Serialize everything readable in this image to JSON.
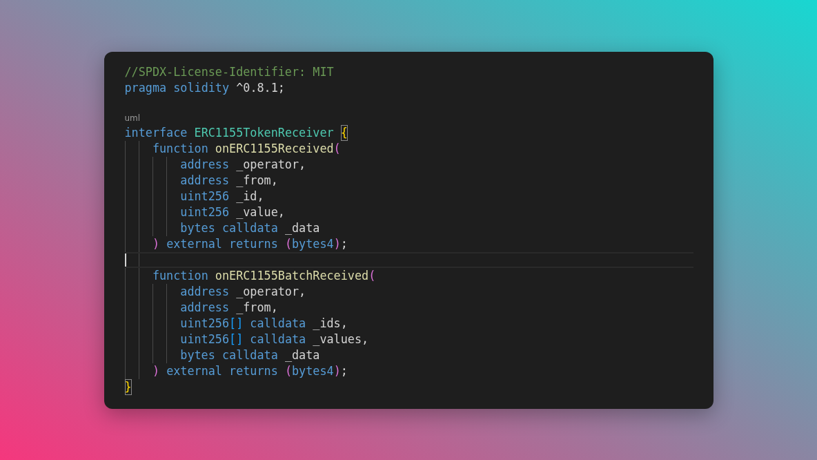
{
  "editor": {
    "lines": [
      {
        "kind": "code",
        "current": false,
        "tokens": [
          {
            "kind": "comment",
            "text": "//SPDX-License-Identifier: MIT"
          }
        ]
      },
      {
        "kind": "code",
        "current": false,
        "tokens": [
          {
            "kind": "keyword",
            "text": "pragma "
          },
          {
            "kind": "keyword",
            "text": "solidity "
          },
          {
            "kind": "plain",
            "text": "^0.8.1;"
          }
        ]
      },
      {
        "kind": "code",
        "current": false
      },
      {
        "kind": "lens",
        "current": false,
        "text": "uml"
      },
      {
        "kind": "code",
        "current": false,
        "tokens": [
          {
            "kind": "keyword",
            "text": "interface "
          },
          {
            "kind": "name",
            "text": "ERC1155TokenReceiver "
          },
          {
            "kind": "brace",
            "text": "{",
            "matched": true
          }
        ],
        "children": [
          {
            "kind": "code",
            "current": false,
            "tokens": [
              {
                "kind": "keyword",
                "text": "function "
              },
              {
                "kind": "function",
                "text": "onERC1155Received"
              },
              {
                "kind": "paren",
                "text": "("
              }
            ],
            "children": [
              {
                "kind": "code",
                "current": false,
                "tokens": [
                  {
                    "kind": "type",
                    "text": "address "
                  },
                  {
                    "kind": "plain",
                    "text": "_operator,"
                  }
                ]
              },
              {
                "kind": "code",
                "current": false,
                "tokens": [
                  {
                    "kind": "type",
                    "text": "address "
                  },
                  {
                    "kind": "plain",
                    "text": "_from,"
                  }
                ]
              },
              {
                "kind": "code",
                "current": false,
                "tokens": [
                  {
                    "kind": "type",
                    "text": "uint256 "
                  },
                  {
                    "kind": "plain",
                    "text": "_id,"
                  }
                ]
              },
              {
                "kind": "code",
                "current": false,
                "tokens": [
                  {
                    "kind": "type",
                    "text": "uint256 "
                  },
                  {
                    "kind": "plain",
                    "text": "_value,"
                  }
                ]
              },
              {
                "kind": "code",
                "current": false,
                "tokens": [
                  {
                    "kind": "type",
                    "text": "bytes "
                  },
                  {
                    "kind": "keyword",
                    "text": "calldata "
                  },
                  {
                    "kind": "plain",
                    "text": "_data"
                  }
                ]
              }
            ]
          },
          {
            "kind": "code",
            "current": false,
            "tokens": [
              {
                "kind": "paren",
                "text": ") "
              },
              {
                "kind": "keyword",
                "text": "external "
              },
              {
                "kind": "keyword",
                "text": "returns "
              },
              {
                "kind": "paren",
                "text": "("
              },
              {
                "kind": "type",
                "text": "bytes4"
              },
              {
                "kind": "paren",
                "text": ")"
              },
              {
                "kind": "plain",
                "text": ";"
              }
            ]
          },
          {
            "kind": "code",
            "current": true
          },
          {
            "kind": "code",
            "current": false,
            "tokens": [
              {
                "kind": "keyword",
                "text": "function "
              },
              {
                "kind": "function",
                "text": "onERC1155BatchReceived"
              },
              {
                "kind": "paren",
                "text": "("
              }
            ],
            "children": [
              {
                "kind": "code",
                "current": false,
                "tokens": [
                  {
                    "kind": "type",
                    "text": "address "
                  },
                  {
                    "kind": "plain",
                    "text": "_operator,"
                  }
                ]
              },
              {
                "kind": "code",
                "current": false,
                "tokens": [
                  {
                    "kind": "type",
                    "text": "address "
                  },
                  {
                    "kind": "plain",
                    "text": "_from,"
                  }
                ]
              },
              {
                "kind": "code",
                "current": false,
                "tokens": [
                  {
                    "kind": "type",
                    "text": "uint256"
                  },
                  {
                    "kind": "bracket",
                    "text": "[] "
                  },
                  {
                    "kind": "keyword",
                    "text": "calldata "
                  },
                  {
                    "kind": "plain",
                    "text": "_ids,"
                  }
                ]
              },
              {
                "kind": "code",
                "current": false,
                "tokens": [
                  {
                    "kind": "type",
                    "text": "uint256"
                  },
                  {
                    "kind": "bracket",
                    "text": "[] "
                  },
                  {
                    "kind": "keyword",
                    "text": "calldata "
                  },
                  {
                    "kind": "plain",
                    "text": "_values,"
                  }
                ]
              },
              {
                "kind": "code",
                "current": false,
                "tokens": [
                  {
                    "kind": "type",
                    "text": "bytes "
                  },
                  {
                    "kind": "keyword",
                    "text": "calldata "
                  },
                  {
                    "kind": "plain",
                    "text": "_data"
                  }
                ]
              }
            ]
          },
          {
            "kind": "code",
            "current": false,
            "tokens": [
              {
                "kind": "paren",
                "text": ") "
              },
              {
                "kind": "keyword",
                "text": "external "
              },
              {
                "kind": "keyword",
                "text": "returns "
              },
              {
                "kind": "paren",
                "text": "("
              },
              {
                "kind": "type",
                "text": "bytes4"
              },
              {
                "kind": "paren",
                "text": ")"
              },
              {
                "kind": "plain",
                "text": ";"
              }
            ]
          }
        ]
      },
      {
        "kind": "code",
        "current": false,
        "tokens": [
          {
            "kind": "brace",
            "text": "}",
            "matched": true
          }
        ]
      }
    ]
  }
}
